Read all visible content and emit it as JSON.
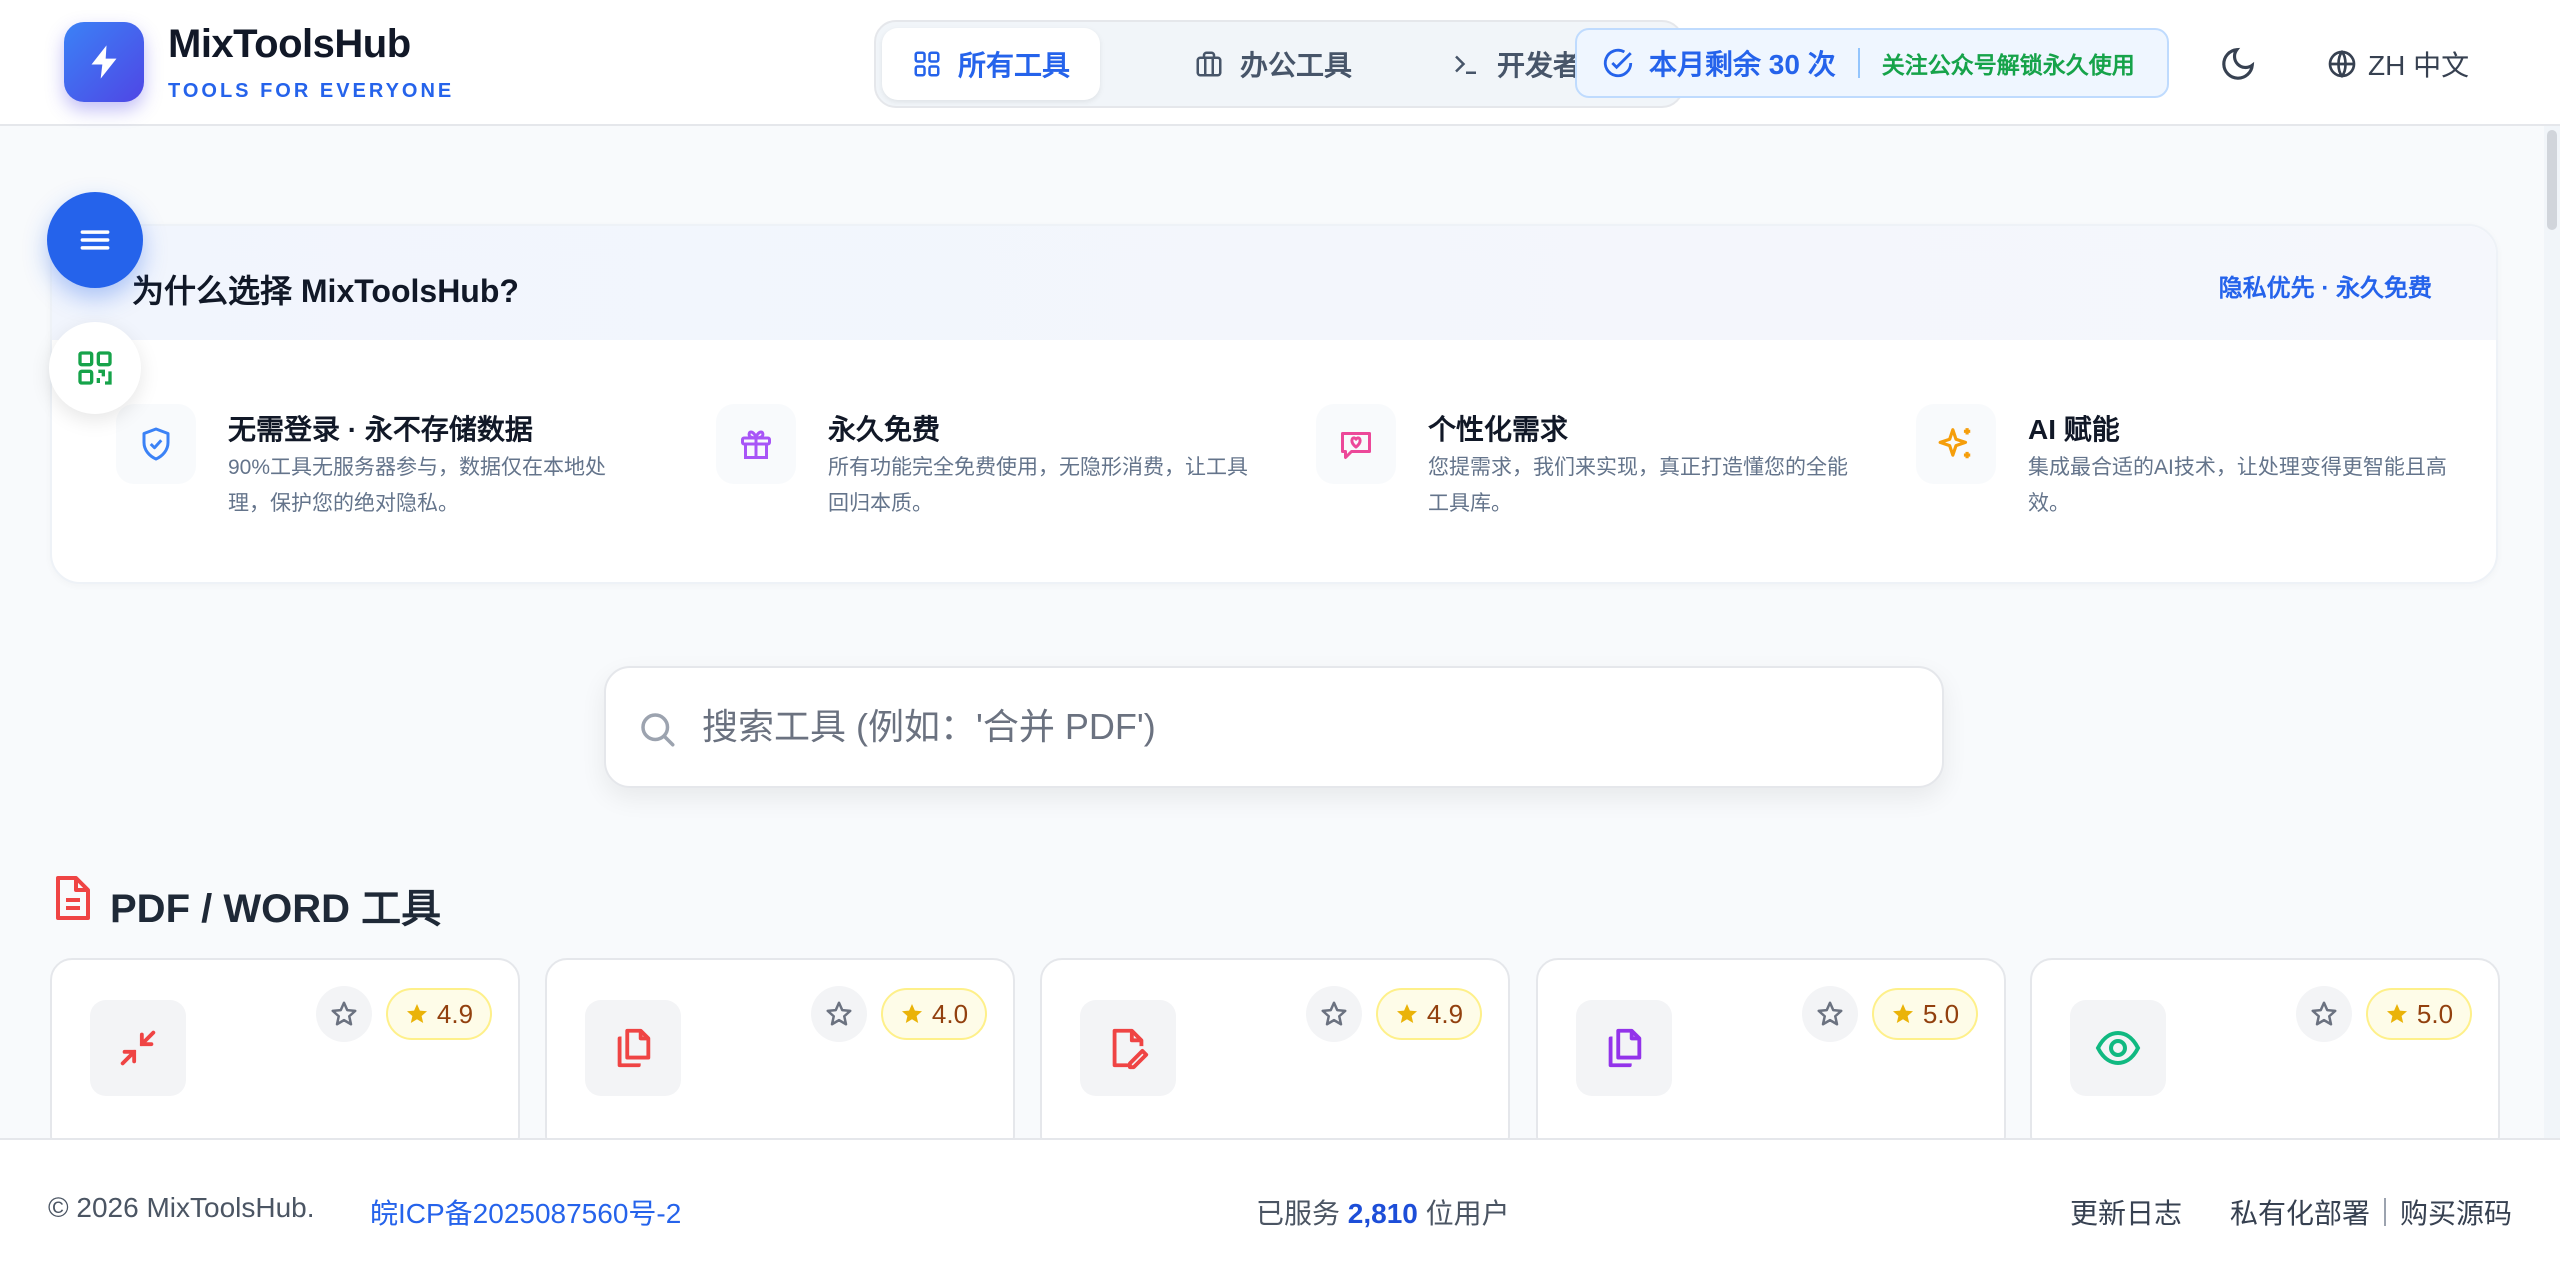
{
  "header": {
    "brand_name": "MixToolsHub",
    "brand_tagline": "TOOLS FOR EVERYONE",
    "nav_tabs": [
      {
        "label": "所有工具",
        "icon": "grid-icon",
        "active": true
      },
      {
        "label": "办公工具",
        "icon": "briefcase-icon",
        "active": false
      },
      {
        "label": "开发者",
        "icon": "terminal-icon",
        "active": false
      }
    ],
    "quota_text": "本月剩余 30 次",
    "quota_cta": "关注公众号解锁永久使用",
    "language": "ZH 中文"
  },
  "why": {
    "title": "为什么选择 MixToolsHub?",
    "badge": "隐私优先 · 永久免费",
    "features": [
      {
        "title": "无需登录 · 永不存储数据",
        "desc": "90%工具无服务器参与，数据仅在本地处理，保护您的绝对隐私。",
        "icon": "shield-check-icon",
        "color": "#3b82f6"
      },
      {
        "title": "永久免费",
        "desc": "所有功能完全免费使用，无隐形消费，让工具回归本质。",
        "icon": "gift-icon",
        "color": "#a855f7"
      },
      {
        "title": "个性化需求",
        "desc": "您提需求，我们来实现，真正打造懂您的全能工具库。",
        "icon": "message-heart-icon",
        "color": "#ec4899"
      },
      {
        "title": "AI 赋能",
        "desc": "集成最合适的AI技术，让处理变得更智能且高效。",
        "icon": "sparkles-icon",
        "color": "#f59e0b"
      }
    ]
  },
  "search": {
    "placeholder": "搜索工具 (例如：'合并 PDF')"
  },
  "section": {
    "title": "PDF / WORD 工具",
    "tools": [
      {
        "icon": "compress-icon",
        "color": "#ef4444",
        "rating": "4.9"
      },
      {
        "icon": "copy-file-icon",
        "color": "#ef4444",
        "rating": "4.0"
      },
      {
        "icon": "file-edit-icon",
        "color": "#ef4444",
        "rating": "4.9"
      },
      {
        "icon": "copy-file-icon",
        "color": "#9333ea",
        "rating": "5.0"
      },
      {
        "icon": "eye-icon",
        "color": "#10b981",
        "rating": "5.0"
      }
    ]
  },
  "footer": {
    "copyright": "© 2026 MixToolsHub.",
    "icp": "皖ICP备2025087560号-2",
    "stats_prefix": "已服务",
    "stats_count": "2,810",
    "stats_suffix": "位用户",
    "changelog": "更新日志",
    "private_deploy": "私有化部署",
    "buy_source": "购买源码"
  }
}
